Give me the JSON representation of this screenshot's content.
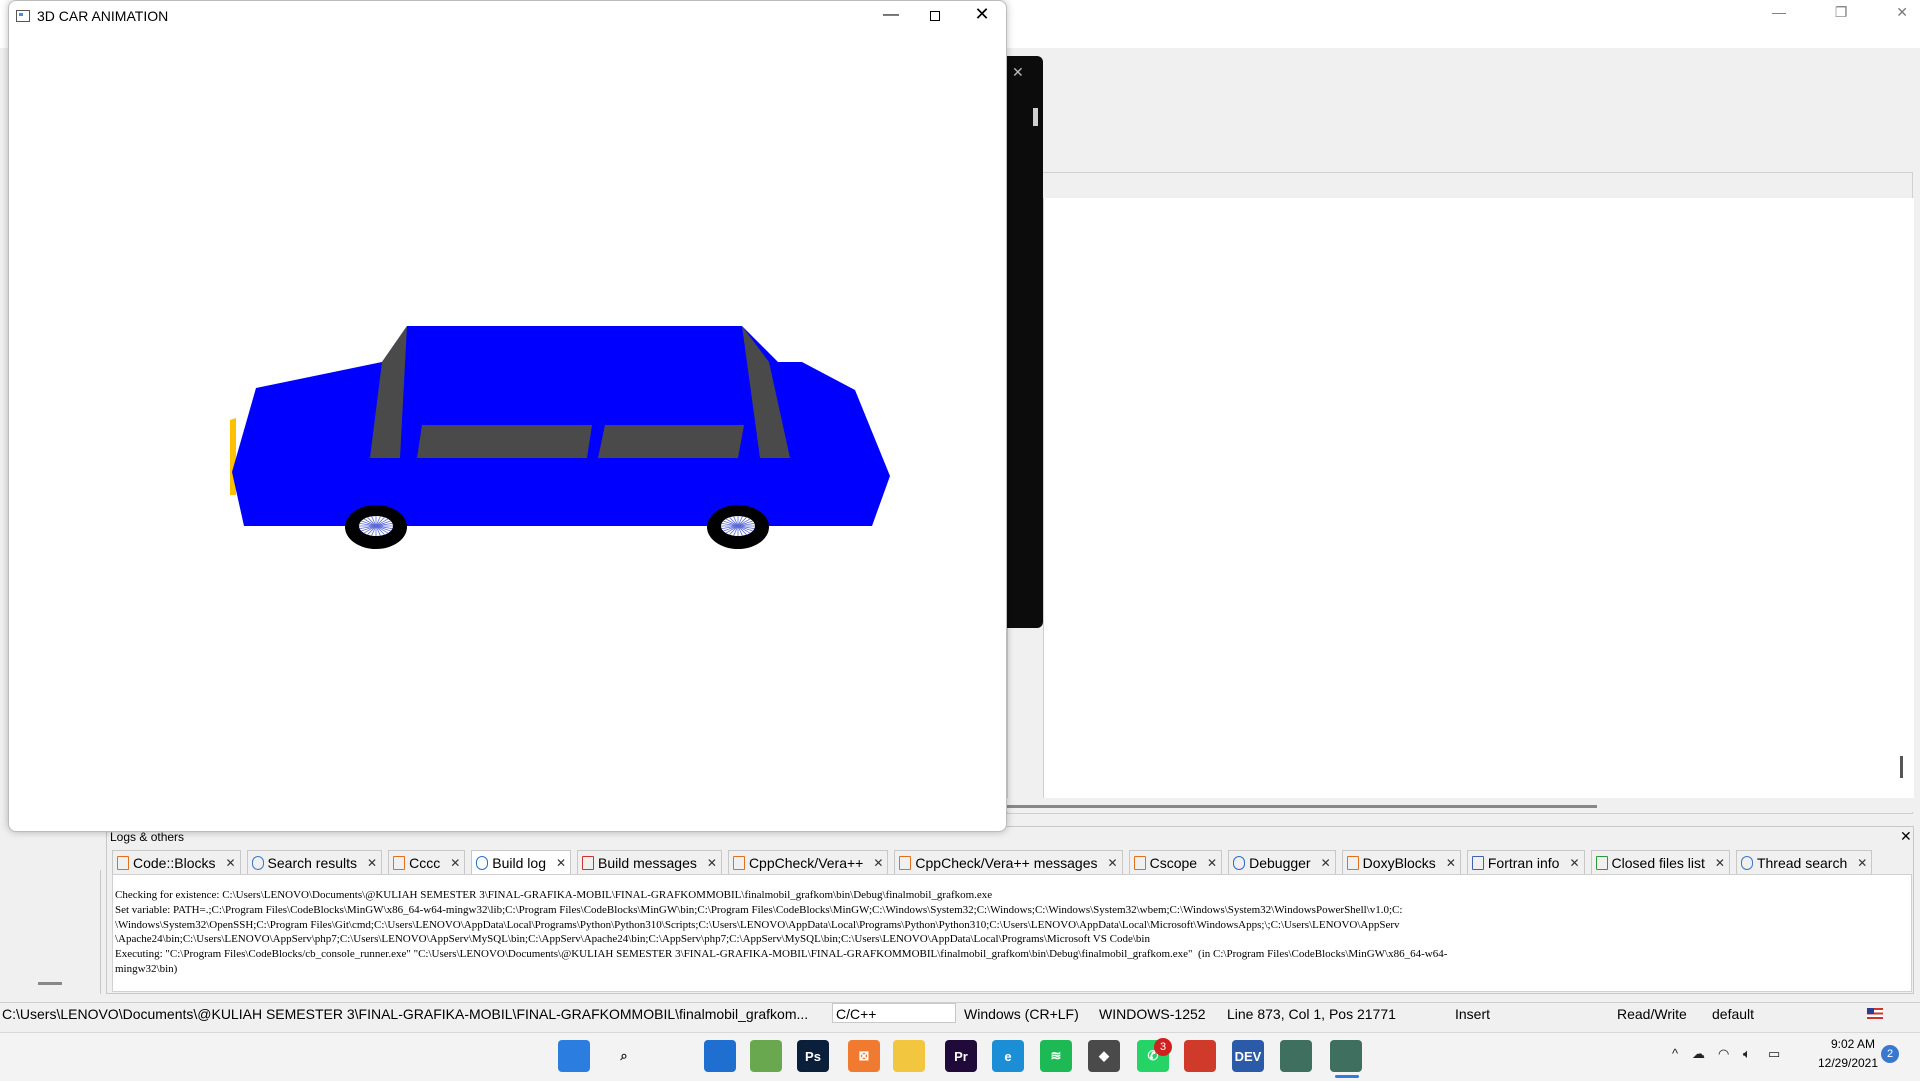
{
  "car_window": {
    "title": "3D CAR ANIMATION",
    "min_glyph": "—",
    "close_glyph": "✕",
    "colors": {
      "body": "#0000ff",
      "glass": "#4a4a4a",
      "tire": "#000000",
      "headlight": "#ffc000"
    }
  },
  "ide": {
    "title_controls": {
      "min": "—",
      "restore": "❐",
      "close": "✕"
    },
    "console_close": "✕"
  },
  "logs": {
    "title": "Logs & others",
    "close_glyph": "✕",
    "tabs": [
      {
        "label": "Code::Blocks",
        "icon": "document-icon"
      },
      {
        "label": "Search results",
        "icon": "search-icon"
      },
      {
        "label": "Cccc",
        "icon": "document-icon"
      },
      {
        "label": "Build log",
        "icon": "gear-icon"
      },
      {
        "label": "Build messages",
        "icon": "pin-icon"
      },
      {
        "label": "CppCheck/Vera++",
        "icon": "document-icon"
      },
      {
        "label": "CppCheck/Vera++ messages",
        "icon": "document-icon"
      },
      {
        "label": "Cscope",
        "icon": "document-icon"
      },
      {
        "label": "Debugger",
        "icon": "gear-icon"
      },
      {
        "label": "DoxyBlocks",
        "icon": "document-icon"
      },
      {
        "label": "Fortran info",
        "icon": "fortran-icon"
      },
      {
        "label": "Closed files list",
        "icon": "recycle-icon"
      },
      {
        "label": "Thread search",
        "icon": "search-icon"
      }
    ],
    "active_tab": "Build log",
    "lines": [
      "Checking for existence: C:\\Users\\LENOVO\\Documents\\@KULIAH SEMESTER 3\\FINAL-GRAFIKA-MOBIL\\FINAL-GRAFKOMMOBIL\\finalmobil_grafkom\\bin\\Debug\\finalmobil_grafkom.exe",
      "Set variable: PATH=.;C:\\Program Files\\CodeBlocks\\MinGW\\x86_64-w64-mingw32\\lib;C:\\Program Files\\CodeBlocks\\MinGW\\bin;C:\\Program Files\\CodeBlocks\\MinGW;C:\\Windows\\System32;C:\\Windows;C:\\Windows\\System32\\wbem;C:\\Windows\\System32\\WindowsPowerShell\\v1.0;C:",
      "\\Windows\\System32\\OpenSSH;C:\\Program Files\\Git\\cmd;C:\\Users\\LENOVO\\AppData\\Local\\Programs\\Python\\Python310\\Scripts;C:\\Users\\LENOVO\\AppData\\Local\\Programs\\Python\\Python310;C:\\Users\\LENOVO\\AppData\\Local\\Microsoft\\WindowsApps;\\;C:\\Users\\LENOVO\\AppServ",
      "\\Apache24\\bin;C:\\Users\\LENOVO\\AppServ\\php7;C:\\Users\\LENOVO\\AppServ\\MySQL\\bin;C:\\AppServ\\Apache24\\bin;C:\\AppServ\\php7;C:\\AppServ\\MySQL\\bin;C:\\Users\\LENOVO\\AppData\\Local\\Programs\\Microsoft VS Code\\bin",
      "Executing: \"C:\\Program Files\\CodeBlocks/cb_console_runner.exe\" \"C:\\Users\\LENOVO\\Documents\\@KULIAH SEMESTER 3\\FINAL-GRAFIKA-MOBIL\\FINAL-GRAFKOMMOBIL\\finalmobil_grafkom\\bin\\Debug\\finalmobil_grafkom.exe\"  (in C:\\Program Files\\CodeBlocks\\MinGW\\x86_64-w64-",
      "mingw32\\bin)"
    ]
  },
  "statusbar": {
    "path": "C:\\Users\\LENOVO\\Documents\\@KULIAH SEMESTER 3\\FINAL-GRAFIKA-MOBIL\\FINAL-GRAFKOMMOBIL\\finalmobil_grafkom...",
    "language": "C/C++",
    "line_endings": "Windows (CR+LF)",
    "encoding": "WINDOWS-1252",
    "position": "Line 873, Col 1, Pos 21771",
    "mode": "Insert",
    "access": "Read/Write",
    "profile": "default"
  },
  "taskbar": {
    "apps": [
      {
        "name": "windows-start-icon",
        "label": "",
        "color": "#2b7de0"
      },
      {
        "name": "search-icon",
        "label": "⌕",
        "color": "#f3f3f3"
      },
      {
        "name": "task-view-icon",
        "label": "",
        "color": "#f3f3f3"
      },
      {
        "name": "widgets-icon",
        "label": "",
        "color": "#1f6fd0"
      },
      {
        "name": "notepadpp-icon",
        "label": "",
        "color": "#6aa84f"
      },
      {
        "name": "photoshop-icon",
        "label": "Ps",
        "color": "#0b1e3a"
      },
      {
        "name": "xampp-icon",
        "label": "⊠",
        "color": "#f07a30"
      },
      {
        "name": "file-explorer-icon",
        "label": "",
        "color": "#f3c640"
      },
      {
        "name": "premiere-icon",
        "label": "Pr",
        "color": "#1f0a3a"
      },
      {
        "name": "edge-icon",
        "label": "e",
        "color": "#1b8ed6"
      },
      {
        "name": "spotify-icon",
        "label": "≋",
        "color": "#1db954"
      },
      {
        "name": "git-icon",
        "label": "◆",
        "color": "#4a4a4a"
      },
      {
        "name": "whatsapp-icon",
        "label": "✆",
        "color": "#25d366"
      },
      {
        "name": "codeblocks-icon",
        "label": "",
        "color": "#d03a2a"
      },
      {
        "name": "devcpp-icon",
        "label": "DEV",
        "color": "#2a5aa8"
      },
      {
        "name": "app-window-icon",
        "label": "",
        "color": "#3f6f5f"
      },
      {
        "name": "car-animation-icon",
        "label": "",
        "color": "#3f6f5f"
      }
    ],
    "whatsapp_badge": "3",
    "clock_time": "9:02 AM",
    "clock_date": "12/29/2021",
    "notifications": "2",
    "tray": {
      "chevron": "^",
      "wifi": "wifi-icon",
      "volume": "volume-icon",
      "battery": "battery-icon",
      "flag": "us-flag-icon"
    }
  }
}
